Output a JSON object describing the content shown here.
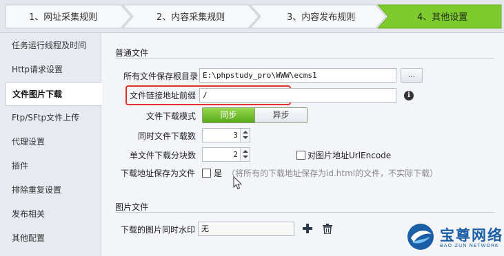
{
  "wizard": {
    "steps": [
      {
        "label": "1、网址采集规则",
        "active": false
      },
      {
        "label": "2、内容采集规则",
        "active": false
      },
      {
        "label": "3、内容发布规则",
        "active": false
      },
      {
        "label": "4、其他设置",
        "active": true
      }
    ]
  },
  "sidebar": {
    "items": [
      {
        "label": "任务运行线程及时间",
        "active": false
      },
      {
        "label": "Http请求设置",
        "active": false
      },
      {
        "label": "文件图片下载",
        "active": true
      },
      {
        "label": "Ftp/SFtp文件上传",
        "active": false
      },
      {
        "label": "代理设置",
        "active": false
      },
      {
        "label": "插件",
        "active": false
      },
      {
        "label": "排除重复设置",
        "active": false
      },
      {
        "label": "发布相关",
        "active": false
      },
      {
        "label": "其他配置",
        "active": false
      }
    ]
  },
  "normal_files": {
    "section_title": "普通文件",
    "root_dir": {
      "label": "所有文件保存根目录",
      "value": "E:\\phpstudy_pro\\WWW\\ecms1",
      "browse_label": "..."
    },
    "link_prefix": {
      "label": "文件链接地址前缀",
      "value": "/"
    },
    "download_mode": {
      "label": "文件下载模式",
      "options": [
        "同步",
        "异步"
      ],
      "selected": "同步"
    },
    "concurrent_downloads": {
      "label": "同时文件下载数",
      "value": "3"
    },
    "chunks_per_file": {
      "label": "单文件下载分块数",
      "value": "2"
    },
    "urlencode_image": {
      "label": "对图片地址UrlEncode",
      "checked": false
    },
    "save_download_url": {
      "label": "下载地址保存为文件",
      "checkbox_label": "是",
      "checked": false,
      "hint": "（将所有的下载地址保存为id.html的文件，不实际下载）"
    }
  },
  "image_files": {
    "section_title": "图片文件",
    "watermark": {
      "label": "下载的图片同时水印",
      "value": "无"
    }
  },
  "logo": {
    "name": "宝尊网络",
    "sub": "BAO ZUN NETWORK"
  },
  "colors": {
    "active_step": "#7ecb2f",
    "highlight": "#e0312a",
    "logo": "#1a5fa6"
  }
}
